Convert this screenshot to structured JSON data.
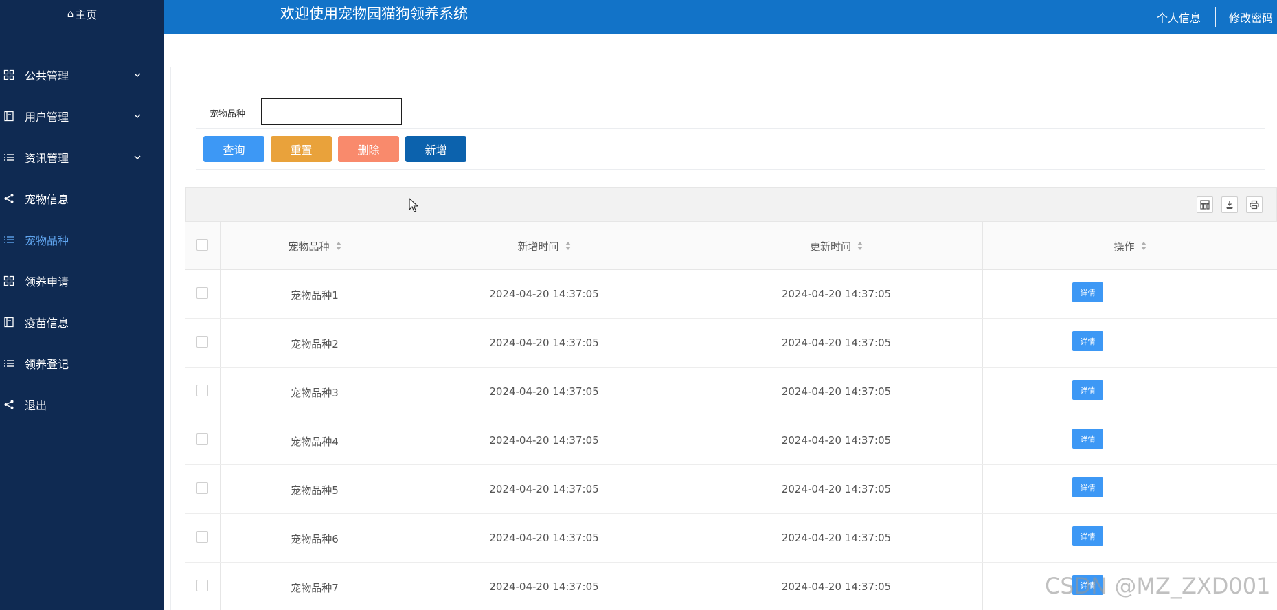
{
  "colors": {
    "sidebar_bg": "#0f2a52",
    "header_bg": "#1273c8",
    "active_menu": "#5fa4ee",
    "btn_query": "#3d98f5",
    "btn_reset": "#e9a23b",
    "btn_delete": "#f98a6c",
    "btn_add": "#0c62ad"
  },
  "sidebar": {
    "home_label": "主页",
    "home_icon": "home-icon",
    "items": [
      {
        "label": "公共管理",
        "icon": "grid-icon",
        "expandable": true
      },
      {
        "label": "用户管理",
        "icon": "book-icon",
        "expandable": true
      },
      {
        "label": "资讯管理",
        "icon": "list-icon",
        "expandable": true
      },
      {
        "label": "宠物信息",
        "icon": "share-icon",
        "expandable": false
      },
      {
        "label": "宠物品种",
        "icon": "list-icon",
        "expandable": false,
        "active": true
      },
      {
        "label": "领养申请",
        "icon": "grid-icon",
        "expandable": false
      },
      {
        "label": "疫苗信息",
        "icon": "book-icon",
        "expandable": false
      },
      {
        "label": "领养登记",
        "icon": "list-icon",
        "expandable": false
      },
      {
        "label": "退出",
        "icon": "share-icon",
        "expandable": false
      }
    ]
  },
  "header": {
    "title": "欢迎使用宠物园猫狗领养系统",
    "profile_link": "个人信息",
    "password_link": "修改密码"
  },
  "search": {
    "label": "宠物品种",
    "value": "",
    "placeholder": ""
  },
  "buttons": {
    "query": "查询",
    "reset": "重置",
    "delete": "删除",
    "add": "新增"
  },
  "table": {
    "toolbar_icons": [
      "columns-icon",
      "export-icon",
      "print-icon"
    ],
    "columns": [
      "宠物品种",
      "新增时间",
      "更新时间",
      "操作"
    ],
    "detail_label": "详情",
    "rows": [
      {
        "breed": "宠物品种1",
        "created": "2024-04-20 14:37:05",
        "updated": "2024-04-20 14:37:05"
      },
      {
        "breed": "宠物品种2",
        "created": "2024-04-20 14:37:05",
        "updated": "2024-04-20 14:37:05"
      },
      {
        "breed": "宠物品种3",
        "created": "2024-04-20 14:37:05",
        "updated": "2024-04-20 14:37:05"
      },
      {
        "breed": "宠物品种4",
        "created": "2024-04-20 14:37:05",
        "updated": "2024-04-20 14:37:05"
      },
      {
        "breed": "宠物品种5",
        "created": "2024-04-20 14:37:05",
        "updated": "2024-04-20 14:37:05"
      },
      {
        "breed": "宠物品种6",
        "created": "2024-04-20 14:37:05",
        "updated": "2024-04-20 14:37:05"
      },
      {
        "breed": "宠物品种7",
        "created": "2024-04-20 14:37:05",
        "updated": "2024-04-20 14:37:05"
      }
    ]
  },
  "watermark": "CSDN @MZ_ZXD001"
}
